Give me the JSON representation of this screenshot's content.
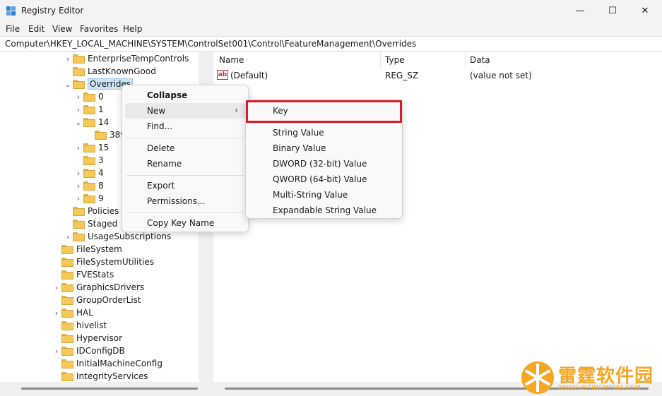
{
  "window": {
    "title": "Registry Editor",
    "controls": {
      "minimize": "—",
      "maximize": "☐",
      "close": "✕"
    }
  },
  "menubar": [
    "File",
    "Edit",
    "View",
    "Favorites",
    "Help"
  ],
  "address": "Computer\\HKEY_LOCAL_MACHINE\\SYSTEM\\ControlSet001\\Control\\FeatureManagement\\Overrides",
  "tree": [
    {
      "label": "EnterpriseTempControls",
      "expander": "›"
    },
    {
      "label": "LastKnownGood",
      "expander": ""
    },
    {
      "label": "Overrides",
      "expander": "⌄",
      "selected": true
    },
    {
      "label": "0",
      "expander": "›"
    },
    {
      "label": "1",
      "expander": "›"
    },
    {
      "label": "14",
      "expander": "⌄"
    },
    {
      "label": "389",
      "expander": ""
    },
    {
      "label": "15",
      "expander": "›"
    },
    {
      "label": "3",
      "expander": ""
    },
    {
      "label": "4",
      "expander": "›"
    },
    {
      "label": "8",
      "expander": "›"
    },
    {
      "label": "9",
      "expander": "›"
    },
    {
      "label": "Policies",
      "expander": ""
    },
    {
      "label": "Staged",
      "expander": ""
    },
    {
      "label": "UsageSubscriptions",
      "expander": "›"
    },
    {
      "label": "FileSystem",
      "expander": ""
    },
    {
      "label": "FileSystemUtilities",
      "expander": ""
    },
    {
      "label": "FVEStats",
      "expander": ""
    },
    {
      "label": "GraphicsDrivers",
      "expander": "›"
    },
    {
      "label": "GroupOrderList",
      "expander": ""
    },
    {
      "label": "HAL",
      "expander": "›"
    },
    {
      "label": "hivelist",
      "expander": ""
    },
    {
      "label": "Hypervisor",
      "expander": ""
    },
    {
      "label": "IDConfigDB",
      "expander": "›"
    },
    {
      "label": "InitialMachineConfig",
      "expander": ""
    },
    {
      "label": "IntegrityServices",
      "expander": ""
    }
  ],
  "list": {
    "columns": [
      "Name",
      "Type",
      "Data"
    ],
    "rows": [
      {
        "icon": "ab",
        "name": "(Default)",
        "type": "REG_SZ",
        "data": "(value not set)"
      }
    ]
  },
  "context_menu": {
    "items": [
      "Collapse",
      "New",
      "Find...",
      "Delete",
      "Rename",
      "Export",
      "Permissions...",
      "Copy Key Name"
    ],
    "submenu_arrow": "›"
  },
  "submenu": {
    "items": [
      "Key",
      "String Value",
      "Binary Value",
      "DWORD (32-bit) Value",
      "QWORD (64-bit) Value",
      "Multi-String Value",
      "Expandable String Value"
    ]
  },
  "watermark": {
    "title": "雷霆软件园",
    "url": "WWW.LEITINGMEDIA.COM"
  },
  "colors": {
    "highlight": "#d21f2c",
    "selection": "#cce4f7",
    "folder": "#f4c95a",
    "watermark": "#f5a623"
  }
}
